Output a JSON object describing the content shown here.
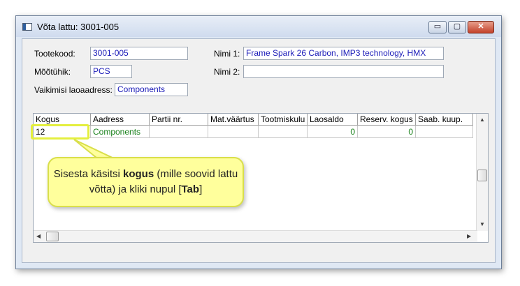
{
  "window": {
    "title": "Võta lattu: 3001-005",
    "buttons": {
      "minimize": "▭",
      "maximize": "▢",
      "close": "✕"
    }
  },
  "form": {
    "tootekood_label": "Tootekood:",
    "tootekood_value": "3001-005",
    "mootuhik_label": "Mõõtühik:",
    "mootuhik_value": "PCS",
    "vaikimisi_label": "Vaikimisi laoaadress:",
    "vaikimisi_value": "Components",
    "nimi1_label": "Nimi 1:",
    "nimi1_value": "Frame Spark 26 Carbon, IMP3 technology, HMX",
    "nimi2_label": "Nimi 2:",
    "nimi2_value": ""
  },
  "grid": {
    "columns": [
      "Kogus",
      "Aadress",
      "Partii nr.",
      "Mat.väärtus",
      "Tootmiskulu",
      "Laosaldo",
      "Reserv. kogus",
      "Saab. kuup."
    ],
    "row": {
      "kogus": "12",
      "aadress": "Components",
      "partii": "",
      "mat": "",
      "tootmiskulu": "",
      "laosaldo": "0",
      "reserv": "0",
      "saab": ""
    }
  },
  "callout": {
    "t1": "Sisesta käsitsi ",
    "b1": "kogus",
    "t2": " (mille soovid lattu võtta) ja kliki nupul [",
    "b2": "Tab",
    "t3": "]"
  },
  "colors": {
    "accent_text": "#1b1bb8",
    "green_text": "#18801a",
    "callout_bg": "#ffff9c",
    "highlight": "#e4ef3f"
  }
}
